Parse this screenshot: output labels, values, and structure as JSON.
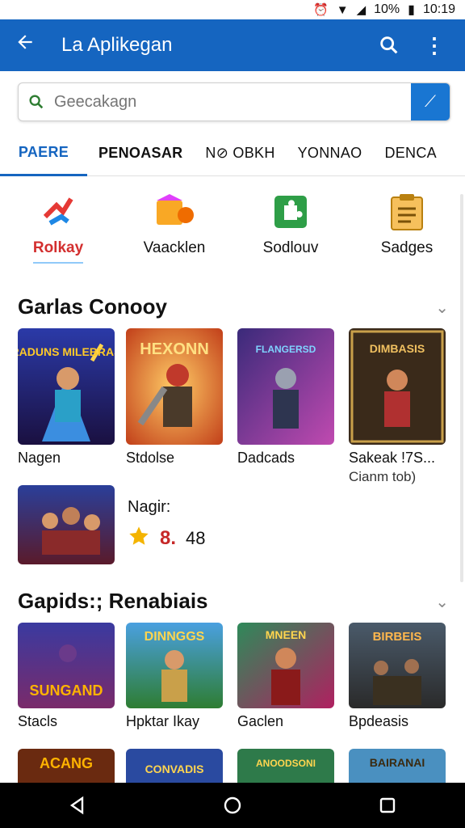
{
  "status": {
    "battery": "10%",
    "time": "10:19"
  },
  "app_bar": {
    "title": "La Aplikegan"
  },
  "search": {
    "placeholder": "Geecakagn"
  },
  "tabs": [
    {
      "label": "PAERE"
    },
    {
      "label": "PENOASAR"
    },
    {
      "label": "N⊘ OBKH"
    },
    {
      "label": "YONNAO"
    },
    {
      "label": "DENCA"
    }
  ],
  "categories": [
    {
      "label": "Rolkay",
      "icon": "puzzle-arrows-icon"
    },
    {
      "label": "Vaacklen",
      "icon": "box-icon"
    },
    {
      "label": "Sodlouv",
      "icon": "puzzle-piece-icon"
    },
    {
      "label": "Sadges",
      "icon": "clipboard-icon"
    }
  ],
  "section1": {
    "title": "Garlas Conooy",
    "items": [
      {
        "art_text": "RADUNS MILEBRAS",
        "label": "Nagen"
      },
      {
        "art_text": "HEXONN",
        "label": "Stdolse"
      },
      {
        "art_text": "FLANGERSD",
        "label": "Dadcads"
      },
      {
        "art_text": "DIMBASIS",
        "label": "Sakeak !7S...",
        "sub": "Cianm tob)"
      },
      {
        "art_text": "",
        "label": ""
      }
    ],
    "rating": {
      "title": "Nagir:",
      "value": "8.",
      "count": "48"
    }
  },
  "section2": {
    "title": "Gapids:; Renabiais",
    "items": [
      {
        "art_text": "SUNGAND",
        "label": "Stacls"
      },
      {
        "art_text": "DINNGGS",
        "label": "Hpktar Ikay"
      },
      {
        "art_text": "MNEEN",
        "label": "Gaclen"
      },
      {
        "art_text": "BIRBEIS",
        "label": "Bpdeasis"
      }
    ]
  },
  "section3": {
    "items": [
      {
        "art_text": "ACANG"
      },
      {
        "art_text": "CONVADIS"
      },
      {
        "art_text": "ANOODSONI"
      },
      {
        "art_text": "BAIRANAI"
      }
    ]
  },
  "colors": {
    "primary": "#1565c0",
    "accent": "#1976d2",
    "star": "#f4b400",
    "rating": "#c62828"
  }
}
